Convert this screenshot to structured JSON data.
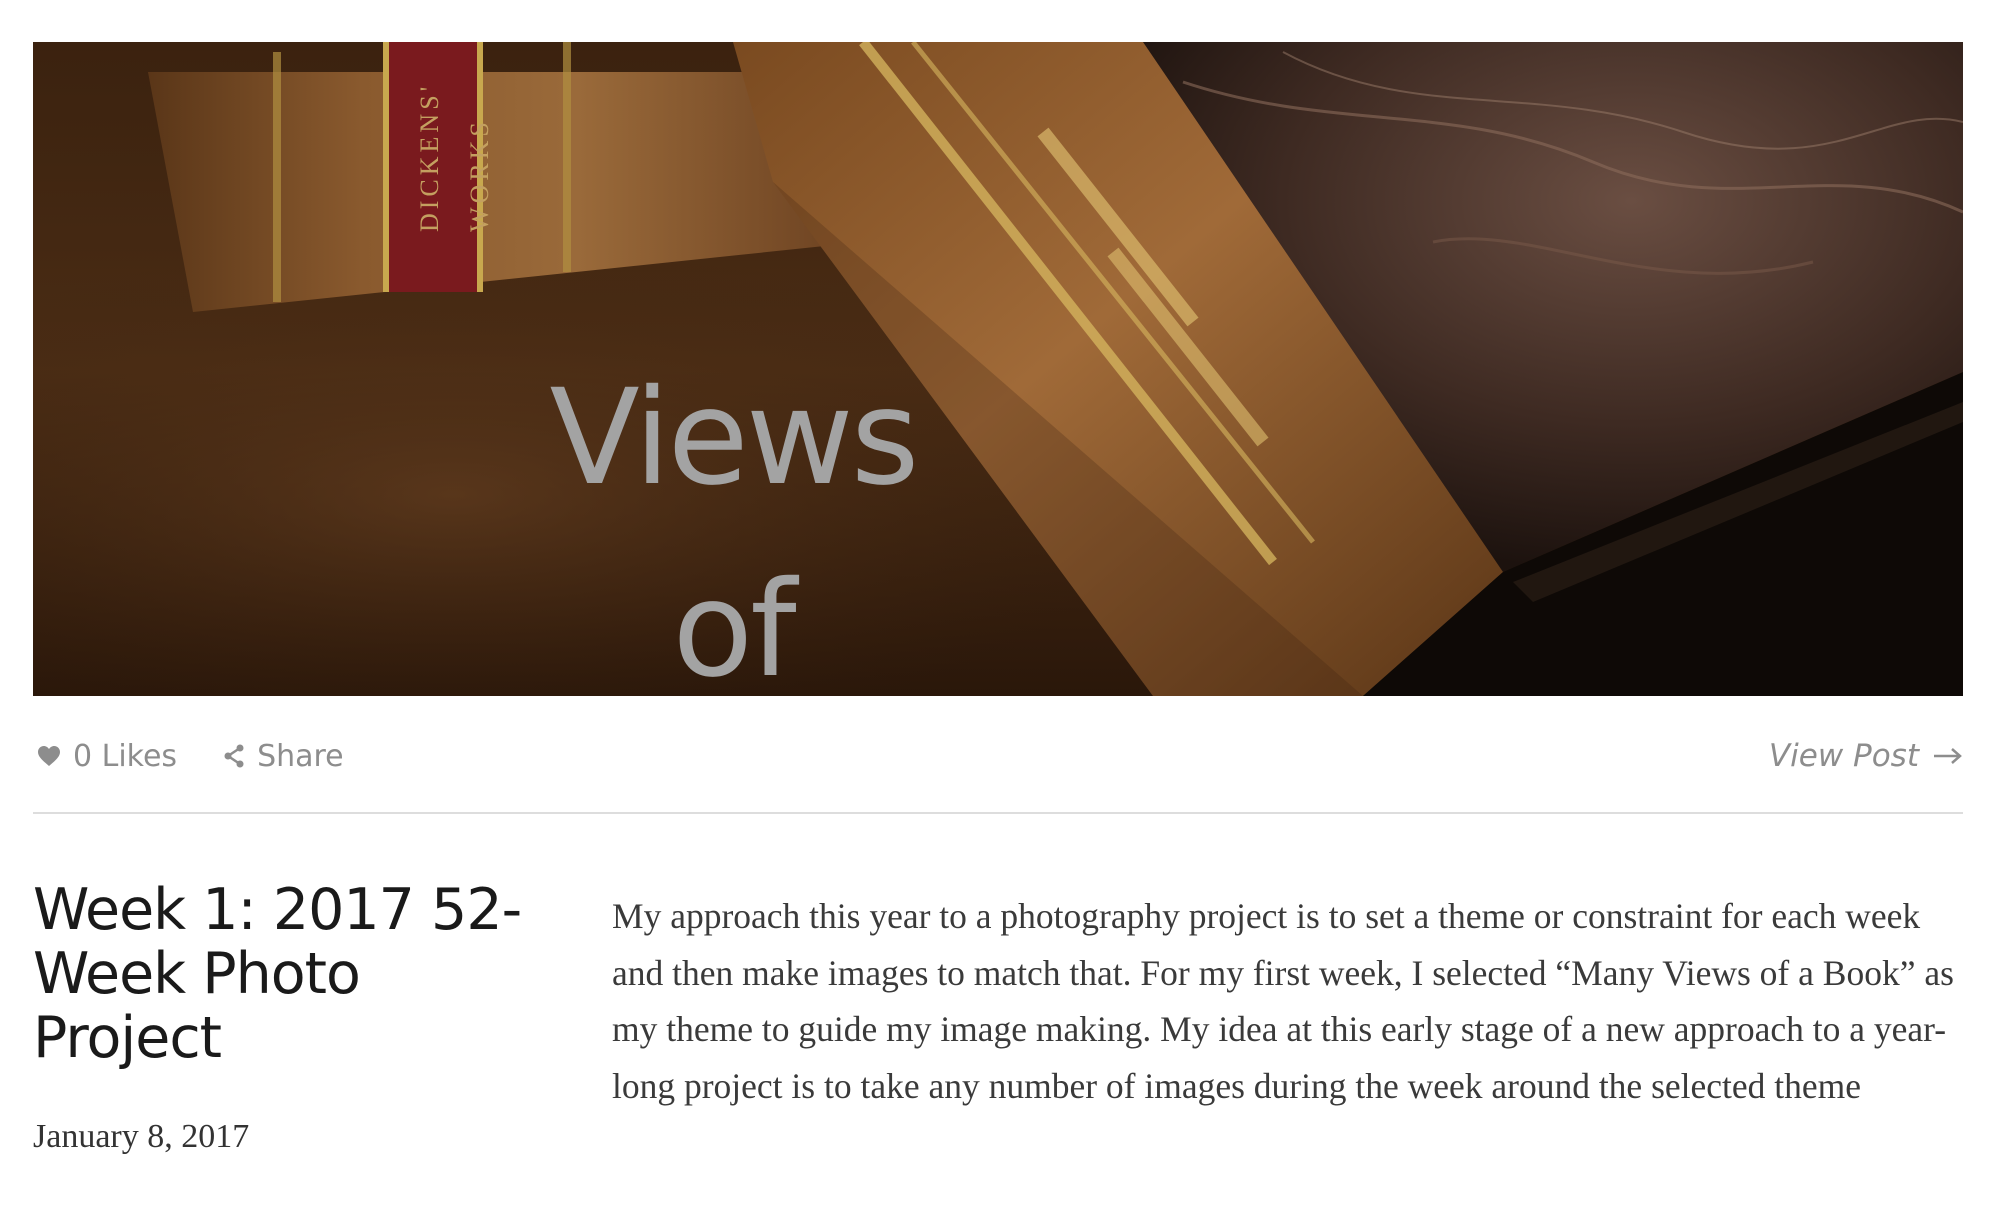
{
  "hero": {
    "overlay_title": "Views of\na Book",
    "spine_text_1": "DICKENS'",
    "spine_text_2": "WORKS"
  },
  "actions": {
    "likes_label": "0 Likes",
    "share_label": "Share",
    "view_post_label": "View Post"
  },
  "post": {
    "title": "Week 1: 2017 52-Week Photo Project",
    "date": "January 8, 2017",
    "excerpt": "My approach this year to a photography project is to set a theme or constraint for each week and then make images to match that. For my first week, I selected “Many Views of a Book” as my theme to guide my image making. My idea at this early stage of a new approach to a year-long project is to take any number of images during the week around the selected theme"
  },
  "icons": {
    "likes": "heart-icon",
    "share": "share-icon",
    "view_post": "arrow-right-icon"
  },
  "colors": {
    "muted_text": "#8d8d8d",
    "divider": "#dddddd",
    "title_text": "#1a1a1a"
  }
}
